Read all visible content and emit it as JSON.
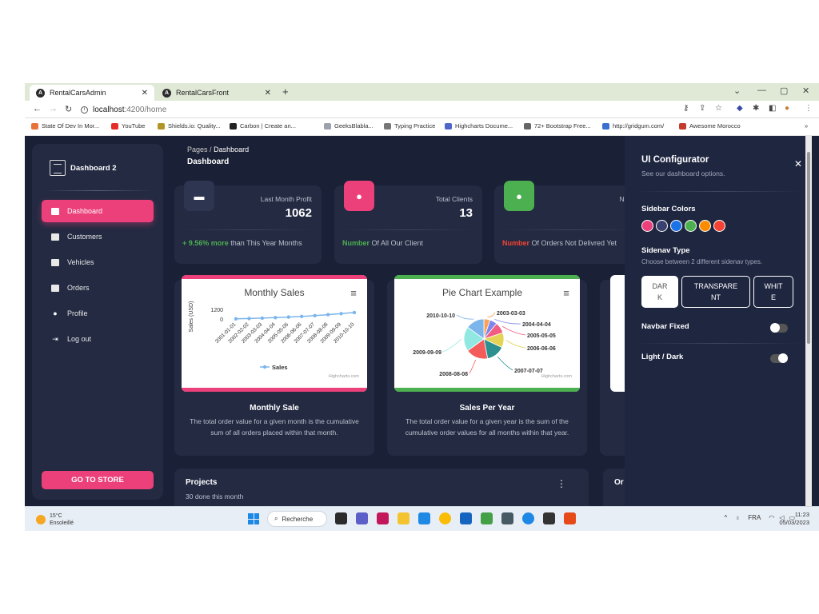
{
  "browser": {
    "tabs": [
      {
        "title": "RentalCarsAdmin",
        "active": true
      },
      {
        "title": "RentalCarsFront",
        "active": false
      }
    ],
    "url_host": "localhost",
    "url_path": ":4200/home",
    "bookmarks": [
      "State Of Dev In Mor...",
      "YouTube",
      "Shields.io: Quality...",
      "Carbon | Create an...",
      "GeeksBlabla...",
      "Typing Practice",
      "Highcharts Docume...",
      "72+ Bootstrap Free...",
      "http://gridgum.com/",
      "Awesome Morocco"
    ]
  },
  "sidebar": {
    "brand": "Dashboard 2",
    "items": [
      {
        "label": "Dashboard",
        "active": true
      },
      {
        "label": "Customers"
      },
      {
        "label": "Vehicles"
      },
      {
        "label": "Orders"
      },
      {
        "label": "Profile"
      },
      {
        "label": "Log out"
      }
    ],
    "go_store": "GO TO STORE"
  },
  "header": {
    "crumb_root": "Pages",
    "crumb_sep": "/",
    "crumb_current": "Dashboard",
    "title": "Dashboard"
  },
  "stats": [
    {
      "label": "Last Month Profit",
      "value": "1062",
      "foot_hl": "+ 9.56% more",
      "foot_rest": " than This Year Months",
      "color": "#344767"
    },
    {
      "label": "Total Clients",
      "value": "13",
      "foot_hl": "Number",
      "foot_rest": " Of All Our Client",
      "color": "#ec407a"
    },
    {
      "label": "New Ord",
      "value": "",
      "foot_hl": "Number",
      "foot_rest": " Of Orders Not Delivred Yet",
      "color": "#4caf50"
    }
  ],
  "cards": [
    {
      "title": "Monthly Sale",
      "desc": "The total order value for a given month is the cumulative sum of all orders placed within that month."
    },
    {
      "title": "Sales Per Year",
      "desc": "The total order value for a given year is the sum of the cumulative order values for all months within that year."
    }
  ],
  "chart_data": [
    {
      "type": "line",
      "title": "Monthly Sales",
      "ylabel": "Sales (USD)",
      "yticks": [
        "1200",
        "0"
      ],
      "ylim": [
        0,
        1200
      ],
      "x": [
        "2001-01-01",
        "2002-02-02",
        "2003-03-03",
        "2004-04-04",
        "2005-05-05",
        "2006-06-06",
        "2007-07-07",
        "2008-08-08",
        "2009-09-09",
        "2010-10-10"
      ],
      "series": [
        {
          "name": "Sales",
          "values": [
            20,
            60,
            110,
            170,
            240,
            320,
            420,
            540,
            670,
            810
          ],
          "color": "#7cb5ec"
        }
      ],
      "credits": "Highcharts.com"
    },
    {
      "type": "pie",
      "title": "Pie Chart Example",
      "labels": [
        "2003-03-03",
        "2004-04-04",
        "2005-05-05",
        "2006-06-06",
        "2007-07-07",
        "2008-08-08",
        "2009-09-09",
        "2010-10-10"
      ],
      "values": [
        5,
        6,
        9,
        12,
        15,
        18,
        20,
        15
      ],
      "colors": [
        "#f7a35c",
        "#8085e9",
        "#f15c80",
        "#e4d354",
        "#2b908f",
        "#f45b5b",
        "#91e8e1",
        "#7cb5ec"
      ],
      "credits": "Highcharts.com"
    }
  ],
  "projects": {
    "title": "Projects",
    "sub": "30 done this month"
  },
  "orders": {
    "title": "Or"
  },
  "config": {
    "title": "UI Configurator",
    "subtitle": "See our dashboard options.",
    "sidebar_colors_label": "Sidebar Colors",
    "sidebar_colors": [
      "#ec407a",
      "#3a416f",
      "#1a73e8",
      "#4caf50",
      "#fb8c00",
      "#f44335"
    ],
    "sidenav_type_label": "Sidenav Type",
    "sidenav_hint": "Choose between 2 different sidenav types.",
    "sidenav_dark": "DAR\nK",
    "sidenav_transparent": "TRANSPARE\nNT",
    "sidenav_white": "WHIT\nE",
    "navbar_fixed_label": "Navbar Fixed",
    "navbar_fixed": false,
    "light_dark_label": "Light / Dark",
    "light_dark": true
  },
  "taskbar": {
    "temp": "15°C",
    "weather": "Ensoleillé",
    "search": "Recherche",
    "lang": "FRA",
    "time": "11:23",
    "date": "05/03/2023"
  }
}
